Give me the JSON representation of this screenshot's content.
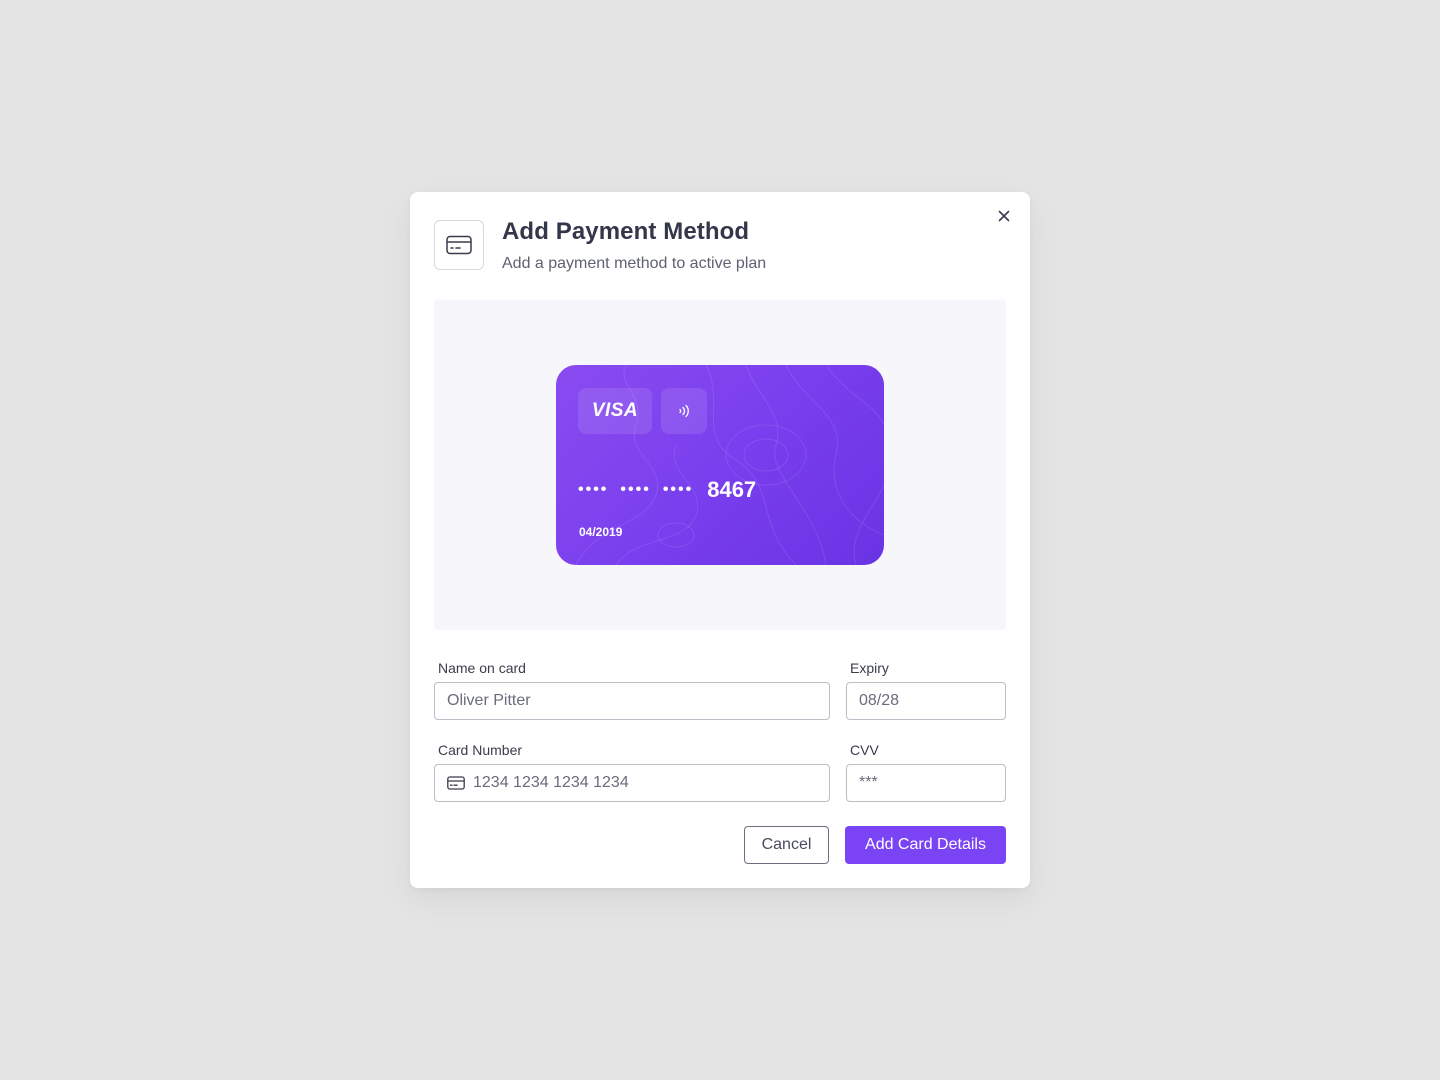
{
  "modal": {
    "title": "Add Payment Method",
    "subtitle": "Add a payment method to active plan",
    "header_icon": "credit-card-icon",
    "close_icon": "close-icon"
  },
  "card_preview": {
    "brand": "VISA",
    "contactless_icon": "contactless-icon",
    "masked_groups": [
      "••••",
      "••••",
      "••••"
    ],
    "last4": "8467",
    "expiry": "04/2019",
    "gradient_colors": [
      "#8a4cf0",
      "#6933e4"
    ]
  },
  "form": {
    "name": {
      "label": "Name on card",
      "value": "Oliver Pitter"
    },
    "expiry": {
      "label": "Expiry",
      "value": "08/28"
    },
    "card_number": {
      "label": "Card Number",
      "placeholder": "1234 1234 1234 1234",
      "icon": "credit-card-icon"
    },
    "cvv": {
      "label": "CVV",
      "value": "***"
    }
  },
  "actions": {
    "cancel_label": "Cancel",
    "submit_label": "Add Card Details"
  },
  "colors": {
    "accent": "#7a44f5",
    "background": "#e4e4e4",
    "preview_bg": "#f7f7fb"
  }
}
